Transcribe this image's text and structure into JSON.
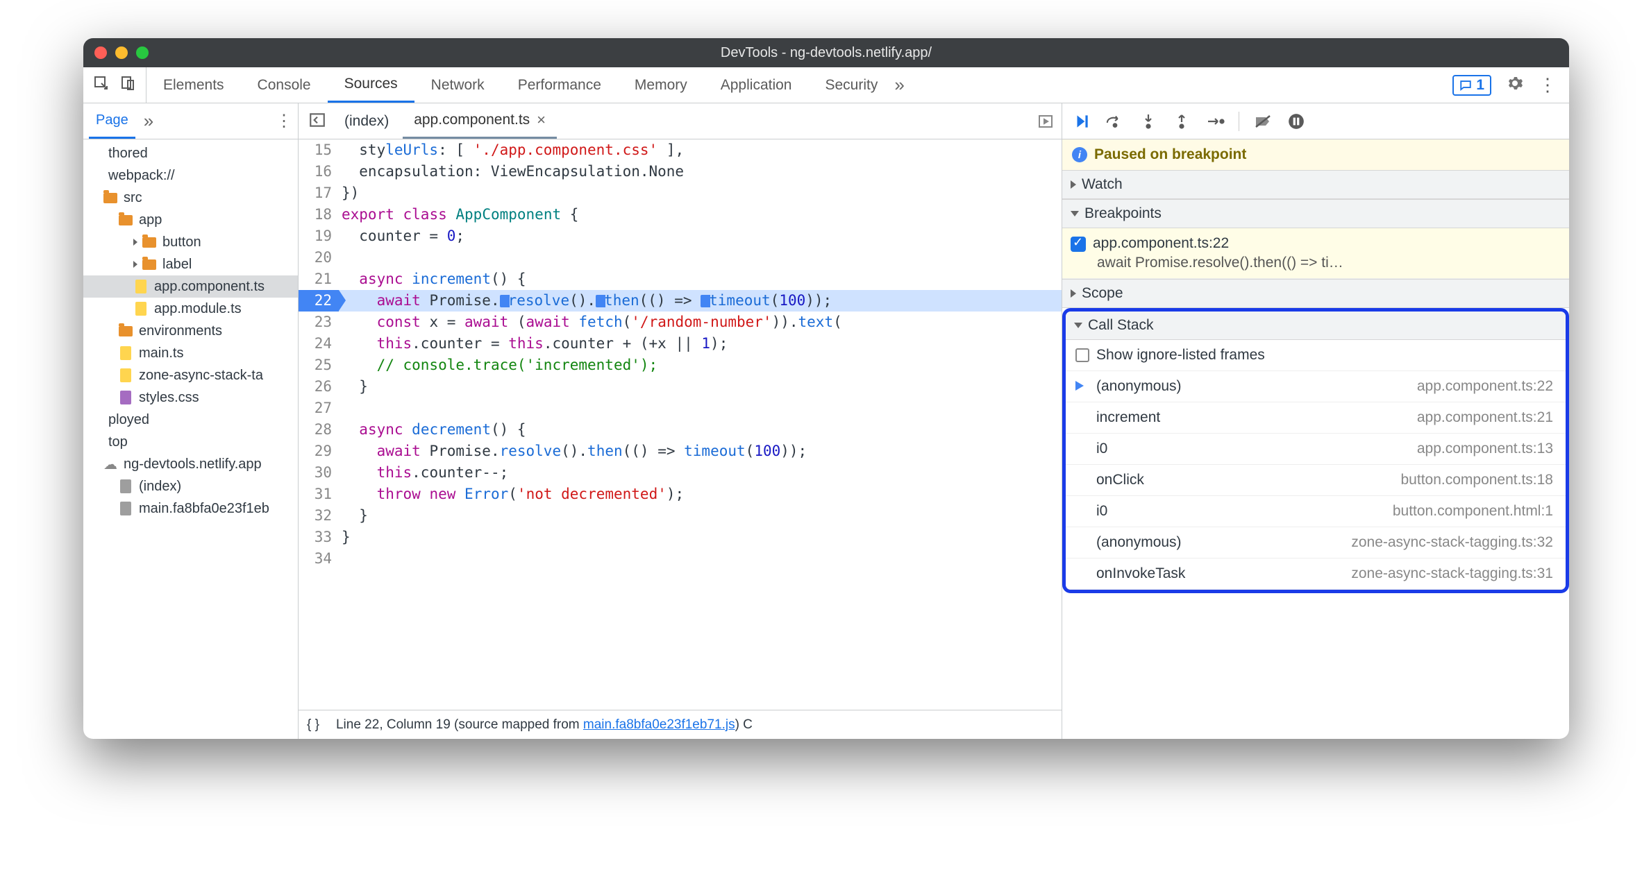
{
  "window": {
    "title": "DevTools - ng-devtools.netlify.app/"
  },
  "panels": [
    "Elements",
    "Console",
    "Sources",
    "Network",
    "Performance",
    "Memory",
    "Application",
    "Security"
  ],
  "active_panel": "Sources",
  "comment_count": "1",
  "sidebar": {
    "active_sub": "Page"
  },
  "file_tree": [
    {
      "label": "thored",
      "indent": 0,
      "type": "text"
    },
    {
      "label": "webpack://",
      "indent": 0,
      "type": "text"
    },
    {
      "label": "src",
      "indent": 1,
      "type": "folder"
    },
    {
      "label": "app",
      "indent": 2,
      "type": "folder"
    },
    {
      "label": "button",
      "indent": 3,
      "type": "folder",
      "expand": true
    },
    {
      "label": "label",
      "indent": 3,
      "type": "folder",
      "expand": true
    },
    {
      "label": "app.component.ts",
      "indent": 3,
      "type": "file",
      "sel": true
    },
    {
      "label": "app.module.ts",
      "indent": 3,
      "type": "file"
    },
    {
      "label": "environments",
      "indent": 2,
      "type": "folder"
    },
    {
      "label": "main.ts",
      "indent": 2,
      "type": "file"
    },
    {
      "label": "zone-async-stack-ta",
      "indent": 2,
      "type": "file"
    },
    {
      "label": "styles.css",
      "indent": 2,
      "type": "file",
      "purple": true
    },
    {
      "label": "ployed",
      "indent": 0,
      "type": "text"
    },
    {
      "label": "top",
      "indent": 0,
      "type": "text"
    },
    {
      "label": "ng-devtools.netlify.app",
      "indent": 1,
      "type": "cloud"
    },
    {
      "label": "(index)",
      "indent": 2,
      "type": "file",
      "gray": true
    },
    {
      "label": "main.fa8bfa0e23f1eb",
      "indent": 2,
      "type": "file",
      "gray": true
    }
  ],
  "editor": {
    "tabs": [
      {
        "label": "(index)",
        "active": false
      },
      {
        "label": "app.component.ts",
        "active": true,
        "closeable": true
      }
    ],
    "lines": [
      {
        "n": 15,
        "html": "  sty<span class='fn'>leUrls</span>: [ <span class='str'>'./app.component.css'</span> ],"
      },
      {
        "n": 16,
        "html": "  encapsulation: ViewEncapsulation.None"
      },
      {
        "n": 17,
        "html": "})"
      },
      {
        "n": 18,
        "html": "<span class='kw'>export</span> <span class='kw'>class</span> <span class='cls'>AppComponent</span> {"
      },
      {
        "n": 19,
        "html": "  counter = <span class='num'>0</span>;"
      },
      {
        "n": 20,
        "html": ""
      },
      {
        "n": 21,
        "html": "  <span class='kw'>async</span> <span class='fn'>increment</span>() {"
      },
      {
        "n": 22,
        "bp": true,
        "html": "    <span class='kw'>await</span> Promise.<span class='marker'></span><span class='fn'>resolve</span>().<span class='marker'></span><span class='fn'>then</span>(() =&gt; <span class='marker'></span><span class='fn'>timeout</span>(<span class='num'>100</span>));"
      },
      {
        "n": 23,
        "html": "    <span class='kw'>const</span> x = <span class='kw'>await</span> (<span class='kw'>await</span> <span class='fn'>fetch</span>(<span class='str'>'/random-number'</span>)).<span class='fn'>text</span>("
      },
      {
        "n": 24,
        "html": "    <span class='kw'>this</span>.counter = <span class='kw'>this</span>.counter + (+x || <span class='num'>1</span>);"
      },
      {
        "n": 25,
        "html": "    <span class='cmt'>// console.trace('incremented');</span>"
      },
      {
        "n": 26,
        "html": "  }"
      },
      {
        "n": 27,
        "html": ""
      },
      {
        "n": 28,
        "html": "  <span class='kw'>async</span> <span class='fn'>decrement</span>() {"
      },
      {
        "n": 29,
        "html": "    <span class='kw'>await</span> Promise.<span class='fn'>resolve</span>().<span class='fn'>then</span>(() =&gt; <span class='fn'>timeout</span>(<span class='num'>100</span>));"
      },
      {
        "n": 30,
        "html": "    <span class='kw'>this</span>.counter--;"
      },
      {
        "n": 31,
        "html": "    <span class='kw'>throw</span> <span class='kw'>new</span> <span class='fn'>Error</span>(<span class='str'>'not decremented'</span>);"
      },
      {
        "n": 32,
        "html": "  }"
      },
      {
        "n": 33,
        "html": "}"
      },
      {
        "n": 34,
        "html": ""
      }
    ],
    "status": {
      "pos": "Line 22, Column 19",
      "mapped_label": "(source mapped from ",
      "mapped_file": "main.fa8bfa0e23f1eb71.js",
      "tail": ") C"
    }
  },
  "debugger": {
    "paused_msg": "Paused on breakpoint",
    "sections": {
      "watch": "Watch",
      "breakpoints": "Breakpoints",
      "scope": "Scope",
      "callstack": "Call Stack"
    },
    "breakpoint": {
      "loc": "app.component.ts:22",
      "snip": "await Promise.resolve().then(() => ti…"
    },
    "ignore_label": "Show ignore-listed frames",
    "callstack": [
      {
        "name": "(anonymous)",
        "loc": "app.component.ts:22",
        "cur": true
      },
      {
        "name": "increment",
        "loc": "app.component.ts:21"
      },
      {
        "name": "i0",
        "loc": "app.component.ts:13"
      },
      {
        "name": "onClick",
        "loc": "button.component.ts:18"
      },
      {
        "name": "i0",
        "loc": "button.component.html:1"
      },
      {
        "name": "(anonymous)",
        "loc": "zone-async-stack-tagging.ts:32"
      },
      {
        "name": "onInvokeTask",
        "loc": "zone-async-stack-tagging.ts:31"
      }
    ]
  }
}
